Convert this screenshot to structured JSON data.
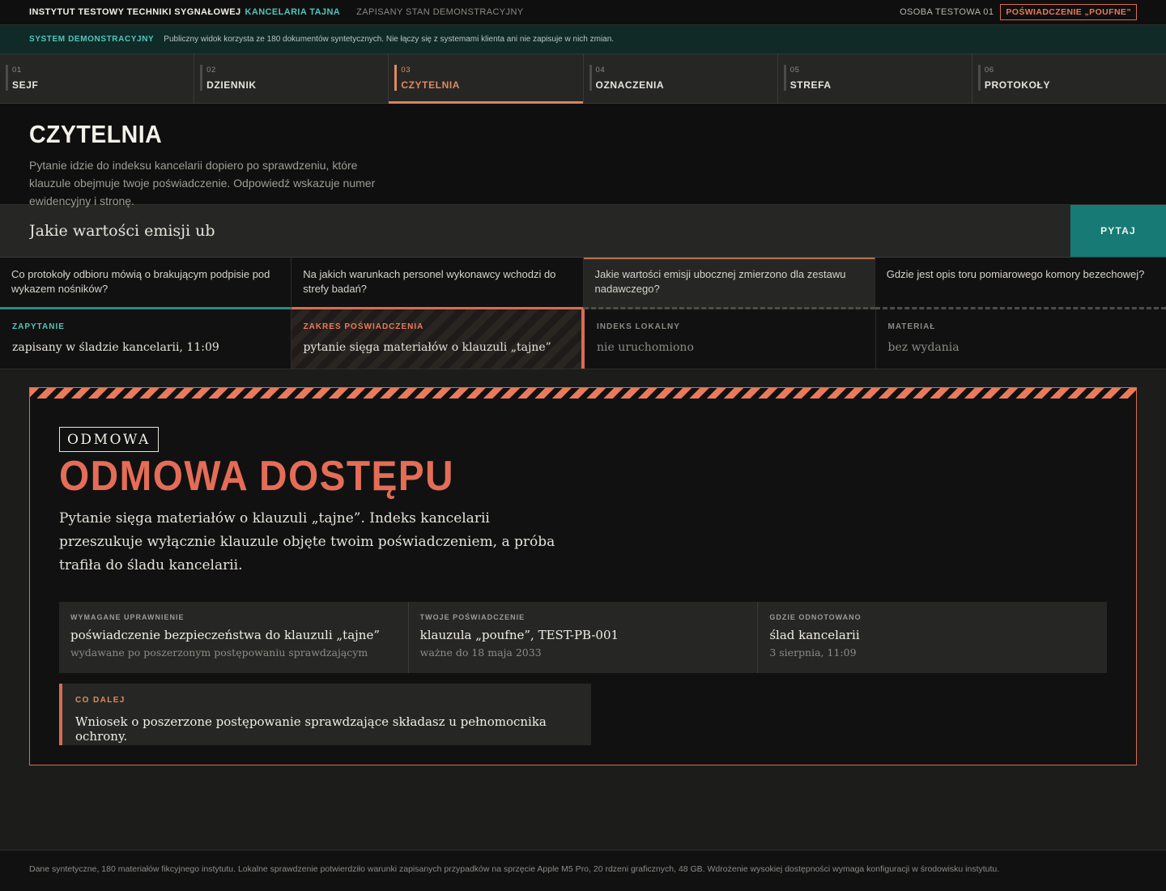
{
  "topbar": {
    "institute": "INSTYTUT TESTOWY TECHNIKI SYGNAŁOWEJ",
    "section": "KANCELARIA TAJNA",
    "state": "ZAPISANY STAN DEMONSTRACYJNY",
    "person": "OSOBA TESTOWA 01",
    "clearance_badge": "POŚWIADCZENIE „POUFNE”"
  },
  "demo_banner": {
    "label": "SYSTEM DEMONSTRACYJNY",
    "text": "Publiczny widok korzysta ze 180 dokumentów syntetycznych. Nie łączy się z systemami klienta ani nie zapisuje w nich zmian."
  },
  "nav": {
    "tabs": [
      {
        "num": "01",
        "label": "SEJF"
      },
      {
        "num": "02",
        "label": "DZIENNIK"
      },
      {
        "num": "03",
        "label": "CZYTELNIA"
      },
      {
        "num": "04",
        "label": "OZNACZENIA"
      },
      {
        "num": "05",
        "label": "STREFA"
      },
      {
        "num": "06",
        "label": "PROTOKOŁY"
      }
    ],
    "active": "CZYTELNIA"
  },
  "page": {
    "title": "CZYTELNIA",
    "description": "Pytanie idzie do indeksu kancelarii dopiero po sprawdzeniu, które klauzule obejmuje twoje poświadczenie. Odpowiedź wskazuje numer ewidencyjny i stronę."
  },
  "query": {
    "value": "Jakie wartości emisji ubocznej zmierzono dla zestawu nadawczego?",
    "button_label": "PYTAJ"
  },
  "suggestions": [
    "Co protokoły odbioru mówią o brakującym podpisie pod wykazem nośników?",
    "Na jakich warunkach personel wykonawcy wchodzi do strefy badań?",
    "Jakie wartości emisji ubocznej zmierzono dla zestawu nadawczego?",
    "Gdzie jest opis toru pomiarowego komory bezechowej?"
  ],
  "status": [
    {
      "key": "ZAPYTANIE",
      "value": "zapisany w śladzie kancelarii, 11:09"
    },
    {
      "key": "ZAKRES POŚWIADCZENIA",
      "value": "pytanie sięga materiałów o klauzuli „tajne”"
    },
    {
      "key": "INDEKS LOKALNY",
      "value": "nie uruchomiono"
    },
    {
      "key": "MATERIAŁ",
      "value": "bez wydania"
    }
  ],
  "denial": {
    "tag": "ODMOWA",
    "title": "ODMOWA DOSTĘPU",
    "lead": "Pytanie sięga materiałów o klauzuli „tajne”. Indeks kancelarii przeszukuje wyłącznie klauzule objęte twoim poświadczeniem, a próba trafiła do śladu kancelarii.",
    "facts": [
      {
        "key": "WYMAGANE UPRAWNIENIE",
        "value": "poświadczenie bezpieczeństwa do klauzuli „tajne”",
        "sub": "wydawane po poszerzonym postępowaniu sprawdzającym"
      },
      {
        "key": "TWOJE POŚWIADCZENIE",
        "value": "klauzula „poufne”, TEST-PB-001",
        "sub": "ważne do 18 maja 2033"
      },
      {
        "key": "GDZIE ODNOTOWANO",
        "value": "ślad kancelarii",
        "sub": "3 sierpnia, 11:09"
      }
    ],
    "next": {
      "key": "CO DALEJ",
      "value": "Wniosek o poszerzone postępowanie sprawdzające składasz u pełnomocnika ochrony."
    }
  },
  "footer": {
    "text": "Dane syntetyczne, 180 materiałów fikcyjnego instytutu. Lokalne sprawdzenie potwierdziło warunki zapisanych przypadków na sprzęcie Apple M5 Pro, 20 rdzeni graficznych, 48 GB. Wdrożenie wysokiej dostępności wymaga konfiguracji w środowisku instytutu."
  },
  "colors": {
    "accent_teal": "#4ec6bd",
    "accent_orange": "#e08a62",
    "danger": "#e46d57",
    "background": "#1c1d1b"
  }
}
